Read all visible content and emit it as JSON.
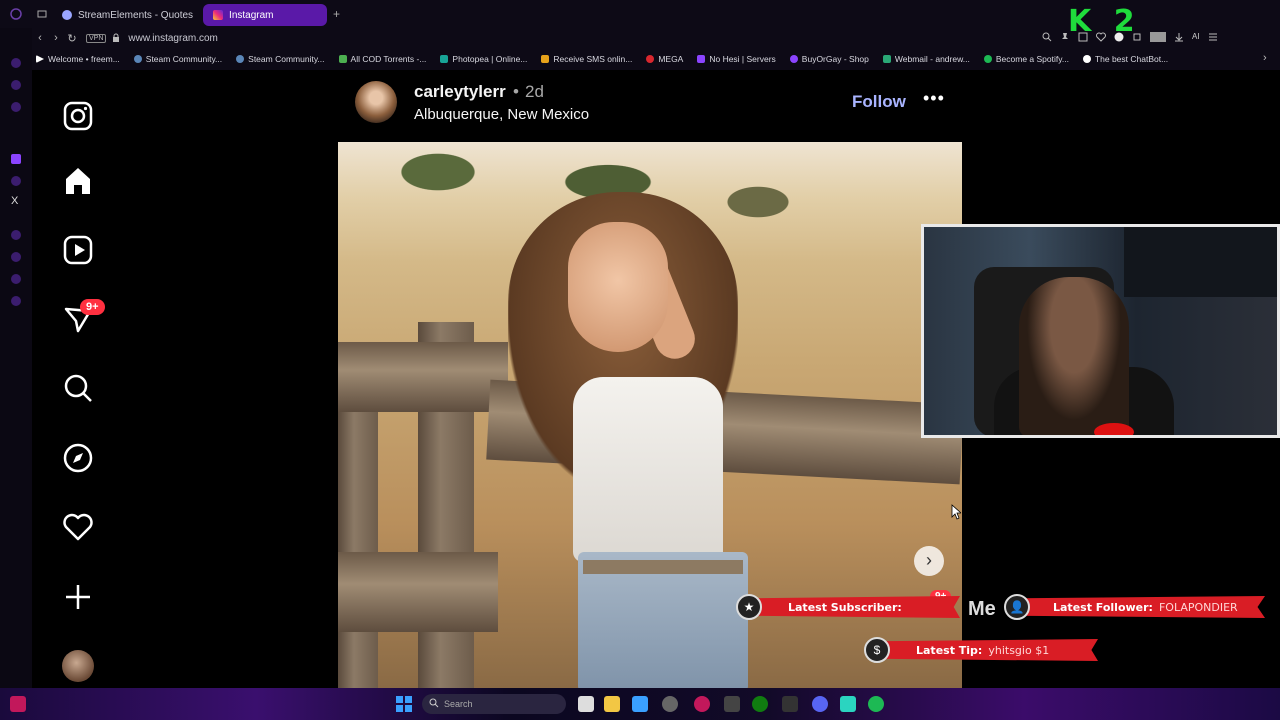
{
  "browser": {
    "tabs": [
      {
        "label": "StreamElements - Quotes",
        "active": false
      },
      {
        "label": "Instagram",
        "active": true
      }
    ],
    "url": "www.instagram.com",
    "vpn_label": "VPN",
    "bookmarks": [
      "Welcome • freem...",
      "Steam Community...",
      "Steam Community...",
      "All COD Torrents -...",
      "Photopea | Online...",
      "Receive SMS onlin...",
      "MEGA",
      "No Hesi | Servers",
      "BuyOrGay - Shop",
      "Webmail - andrew...",
      "Become a Spotify...",
      "The best ChatBot..."
    ]
  },
  "instagram": {
    "nav": {
      "notifications_badge": "9+"
    },
    "post": {
      "username": "carleytylerr",
      "separator": "•",
      "time": "2d",
      "location": "Albuquerque, New Mexico",
      "follow_label": "Follow",
      "more_label": "•••"
    },
    "next_label": "›"
  },
  "overlay": {
    "latest_subscriber_label": "Latest Subscriber:",
    "latest_follower_label": "Latest Follower:",
    "latest_follower_value": "FOLAPONDIER",
    "latest_tip_label": "Latest Tip:",
    "latest_tip_value": "yhitsgio $1",
    "partial_text": "Me",
    "partial_badge": "9+",
    "corner_logo": "K 2"
  },
  "taskbar": {
    "search_placeholder": "Search"
  },
  "colors": {
    "tab_active": "#5a19a8",
    "follow": "#a9b4ff",
    "badge": "#ff3040",
    "alert": "#d91d25",
    "logo": "#1fdc3c"
  }
}
